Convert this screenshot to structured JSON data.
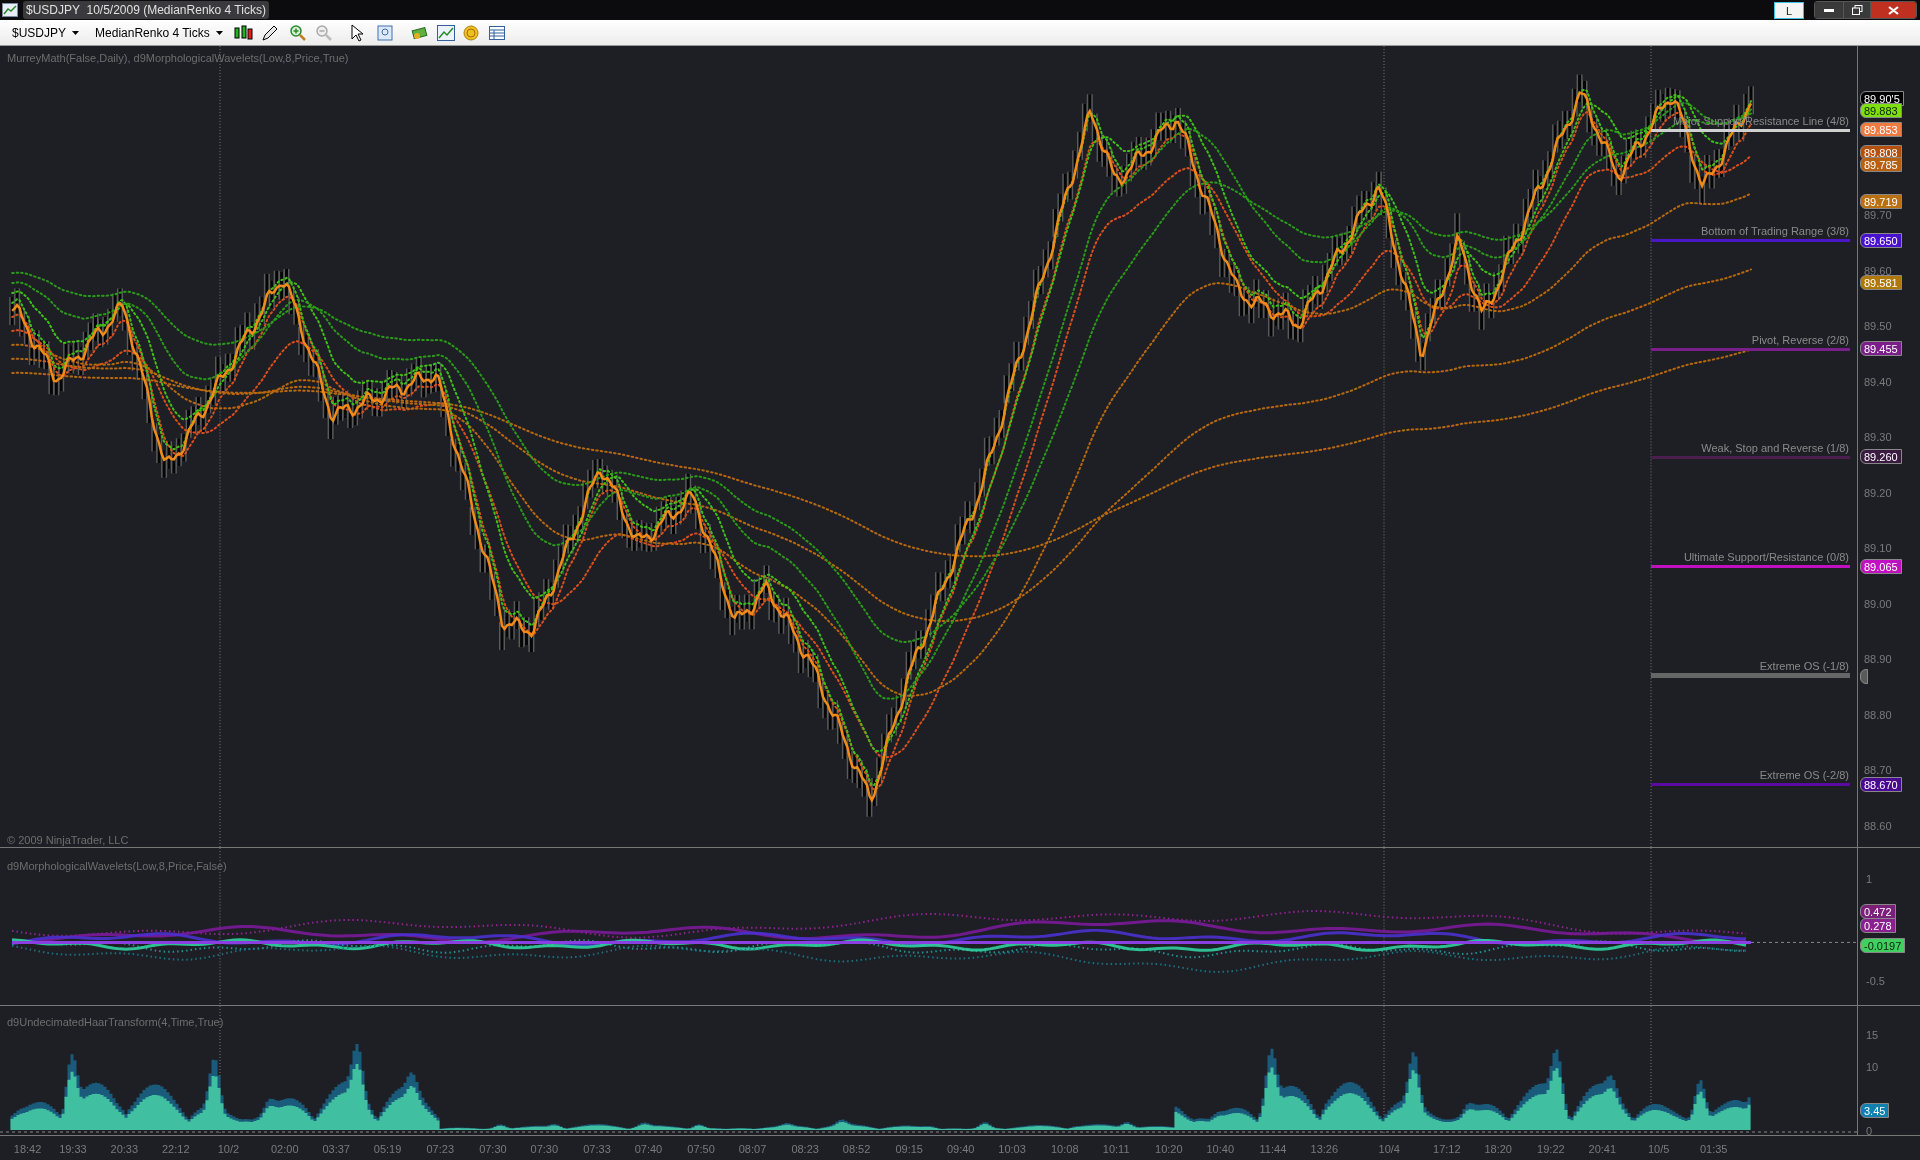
{
  "window": {
    "title": "$USDJPY  10/5/2009 (MedianRenko 4 Ticks)",
    "language_button": "L"
  },
  "toolbar": {
    "instrument": "$USDJPY",
    "bar_type": "MedianRenko 4 Ticks"
  },
  "price_panel": {
    "indicator_label": "MurreyMath(False,Daily), d9MorphologicalWavelets(Low,8,Price,True)",
    "copyright": "© 2009 NinjaTrader, LLC",
    "y_ticks": [
      "89.70",
      "89.60",
      "89.50",
      "89.40",
      "89.30",
      "89.20",
      "89.10",
      "89.00",
      "88.90",
      "88.80",
      "88.70",
      "88.60"
    ],
    "levels": [
      {
        "label": "Major Support/Resistance Line (4/8)",
        "color": "#d0d0d0"
      },
      {
        "label": "Bottom of Trading Range (3/8)",
        "color": "#4b18c8"
      },
      {
        "label": "Pivot, Reverse (2/8)",
        "color": "#7a1f8a"
      },
      {
        "label": "Weak, Stop and Reverse (1/8)",
        "color": "#4a1f4f"
      },
      {
        "label": "Ultimate Support/Resistance (0/8)",
        "color": "#c010c0"
      },
      {
        "label": "Extreme OS (-1/8)",
        "color": "#666666"
      },
      {
        "label": "Extreme OS (-2/8)",
        "color": "#5a0aa0"
      }
    ],
    "markers": [
      {
        "value": "89.90'5",
        "color": "#000000"
      },
      {
        "value": "89.883",
        "color": "#7fe010"
      },
      {
        "value": "89.853",
        "color": "#f07a40"
      },
      {
        "value": "89.808",
        "color": "#b5500c"
      },
      {
        "value": "89.785",
        "color": "#b86010"
      },
      {
        "value": "89.719",
        "color": "#b87010"
      },
      {
        "value": "89.650",
        "color": "#4a10d0"
      },
      {
        "value": "89.581",
        "color": "#b07808"
      },
      {
        "value": "89.455",
        "color": "#7a1f8a"
      },
      {
        "value": "89.260",
        "color": "#3a1a40"
      },
      {
        "value": "89.065",
        "color": "#c010c0"
      },
      {
        "color": "#5a5a5a"
      },
      {
        "value": "88.670",
        "color": "#4a0a90"
      }
    ]
  },
  "wavelet_panel": {
    "label": "d9MorphologicalWavelets(Low,8,Price,False)",
    "y_ticks": [
      "1",
      "-0.5"
    ],
    "markers": [
      {
        "value": "0.472",
        "color": "#7a1f7a"
      },
      {
        "value": "0.278",
        "color": "#8a2090"
      },
      {
        "value": "-0.0197",
        "color": "#40d060"
      }
    ]
  },
  "haar_panel": {
    "label": "d9UndecimatedHaarTransform(4,Time,True)",
    "y_ticks": [
      "15",
      "10",
      "0"
    ],
    "markers": [
      {
        "value": "3.45",
        "color": "#1080b0"
      }
    ]
  },
  "time_axis": [
    "18:42",
    "19:33",
    "20:33",
    "22:12",
    "10/2",
    "02:00",
    "03:37",
    "05:19",
    "07:23",
    "07:30",
    "07:30",
    "07:33",
    "07:40",
    "07:50",
    "08:07",
    "08:23",
    "08:52",
    "09:15",
    "09:40",
    "10:03",
    "10:08",
    "10:11",
    "10:20",
    "10:40",
    "11:44",
    "13:26",
    "10/4",
    "17:12",
    "18:20",
    "19:22",
    "20:41",
    "10/5",
    "01:35"
  ]
}
